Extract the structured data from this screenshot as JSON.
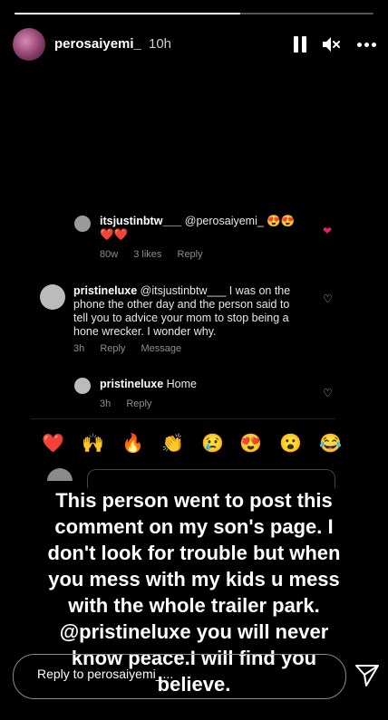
{
  "story": {
    "progress_fraction": 0.63,
    "username": "perosaiyemi_",
    "time_ago": "10h",
    "icons": {
      "pause": "pause-icon",
      "mute": "speaker-muted-icon",
      "more": "more-options-icon",
      "send": "send-icon"
    }
  },
  "comments": [
    {
      "user": "itsjustinbtw___",
      "text": "@perosaiyemi_ 😍😍",
      "text2": "❤️❤️",
      "age": "80w",
      "likes": "3 likes",
      "reply": "Reply",
      "liked": true
    },
    {
      "user": "pristineluxe",
      "text": "@itsjustinbtw___ I was on the",
      "lines": [
        "phone the other day and the person said to",
        "tell you to advice your mom to stop being a",
        "hone wrecker. I wonder why."
      ],
      "age": "3h",
      "reply": "Reply",
      "message": "Message",
      "liked": false
    },
    {
      "user": "pristineluxe",
      "text": "Home",
      "age": "3h",
      "reply": "Reply",
      "liked": false
    }
  ],
  "emojis": [
    "❤️",
    "🙌",
    "🔥",
    "👏",
    "😢",
    "😍",
    "😮",
    "😂"
  ],
  "caption": "This person went to post this comment on my son's page. I don't  look for trouble but when you mess with my kids u mess with the whole trailer park. @pristineluxe you will never know peace.I will find you believe.",
  "reply_placeholder": "Reply to perosaiyemi_..."
}
